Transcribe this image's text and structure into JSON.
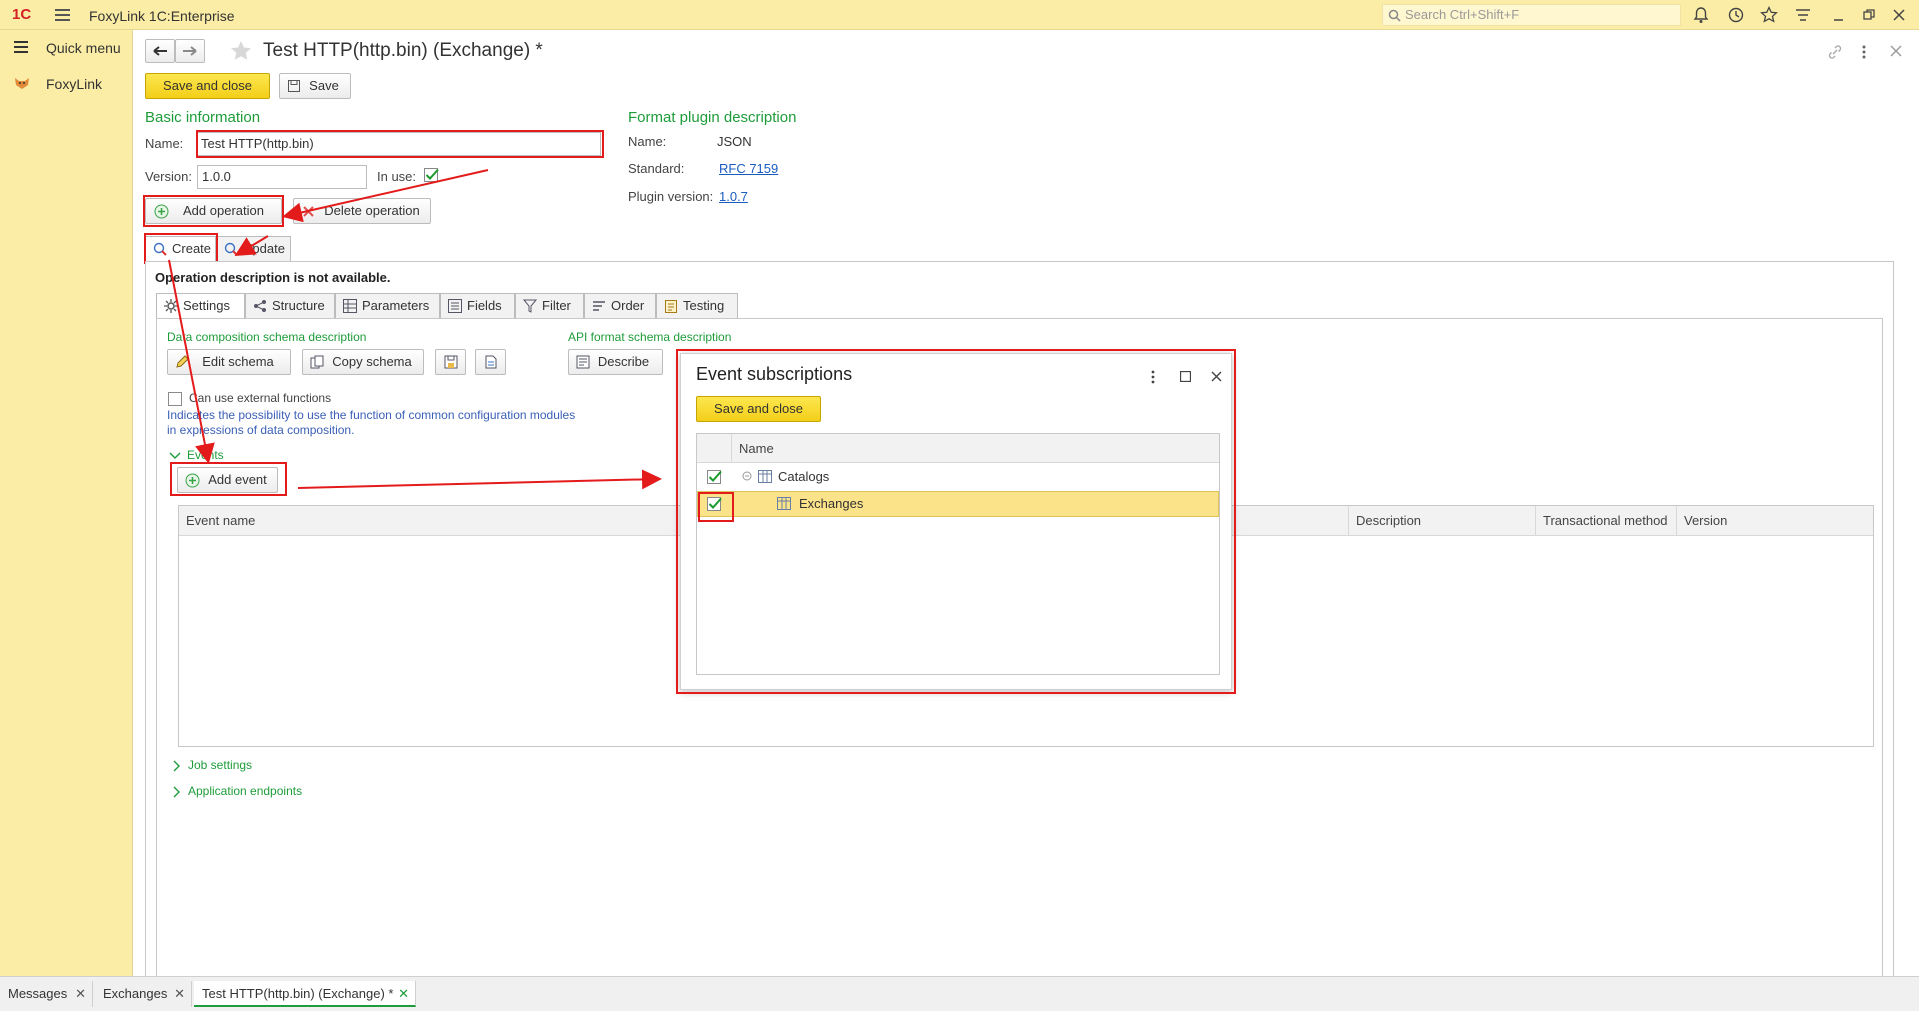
{
  "app": {
    "title": "FoxyLink 1C:Enterprise",
    "logo": "1C"
  },
  "search": {
    "placeholder": "Search Ctrl+Shift+F"
  },
  "sidebar": {
    "items": [
      {
        "label": "Quick menu",
        "icon": "menu-icon"
      },
      {
        "label": "FoxyLink",
        "icon": "foxylink-icon"
      }
    ]
  },
  "form": {
    "title": "Test HTTP(http.bin) (Exchange) *",
    "save_close": "Save and close",
    "save": "Save"
  },
  "basic": {
    "heading": "Basic information",
    "name_label": "Name:",
    "name_value": "Test HTTP(http.bin)",
    "version_label": "Version:",
    "version_value": "1.0.0",
    "in_use_label": "In use:",
    "in_use": true,
    "add_operation": "Add operation",
    "delete_operation": "Delete operation"
  },
  "plugin": {
    "heading": "Format plugin description",
    "name_label": "Name:",
    "name_value": "JSON",
    "standard_label": "Standard:",
    "standard_value": "RFC 7159",
    "version_label": "Plugin version:",
    "version_value": "1.0.7"
  },
  "operation_tabs": [
    "Create",
    "Update"
  ],
  "operation_note": "Operation description is not available.",
  "tabs": [
    "Settings",
    "Structure",
    "Parameters",
    "Fields",
    "Filter",
    "Order",
    "Testing"
  ],
  "settings": {
    "dcs_heading": "Data composition schema description",
    "edit_schema": "Edit schema",
    "copy_schema": "Copy schema",
    "api_heading": "API format schema description",
    "describe": "Describe",
    "external_label": "Can use external functions",
    "hint": "Indicates the possibility to use the function of common configuration modules in expressions of data composition.",
    "events_label": "Events",
    "add_event": "Add event",
    "columns": [
      "Event name",
      "Description",
      "Transactional method",
      "Version"
    ],
    "job_settings": "Job settings",
    "app_endpoints": "Application endpoints"
  },
  "dialog": {
    "title": "Event subscriptions",
    "save_close": "Save and close",
    "column_name": "Name",
    "rows": [
      {
        "label": "Catalogs",
        "checked": true,
        "selected": false
      },
      {
        "label": "Exchanges",
        "checked": true,
        "selected": true
      }
    ]
  },
  "bottom_tabs": [
    "Messages",
    "Exchanges",
    "Test HTTP(http.bin) (Exchange) *"
  ],
  "colors": {
    "accent_yellow": "#fbeda6",
    "button_yellow": "#f5d31f",
    "green_heading": "#1e9c3a",
    "annotation_red": "#e31b1b",
    "selection": "#fbe38a"
  }
}
